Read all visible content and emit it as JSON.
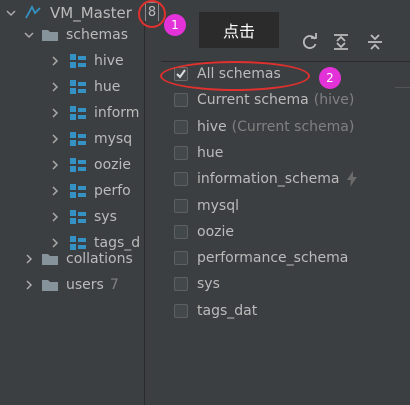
{
  "tree": {
    "datasource": "VM_Master",
    "schemas_label": "schemas",
    "schema_items": [
      "hive",
      "hue",
      "inform",
      "mysq",
      "oozie",
      "perfo",
      "sys",
      "tags_d"
    ],
    "collations_label": "collations",
    "users_label": "users",
    "users_count": "7"
  },
  "badge": {
    "value": "8"
  },
  "annotation": {
    "tooltip": "点击",
    "marker1": "1",
    "marker2": "2"
  },
  "popup": {
    "toolbar": [
      "refresh-icon",
      "expand-all-icon",
      "collapse-all-icon"
    ],
    "options": [
      {
        "label": "All schemas",
        "checked": true,
        "note": ""
      },
      {
        "label": "Current schema",
        "checked": false,
        "note": "(hive)"
      },
      {
        "label": "hive",
        "checked": false,
        "note": "(Current schema)"
      },
      {
        "label": "hue",
        "checked": false,
        "note": ""
      },
      {
        "label": "information_schema",
        "checked": false,
        "note": ""
      },
      {
        "label": "mysql",
        "checked": false,
        "note": ""
      },
      {
        "label": "oozie",
        "checked": false,
        "note": ""
      },
      {
        "label": "performance_schema",
        "checked": false,
        "note": ""
      },
      {
        "label": "sys",
        "checked": false,
        "note": ""
      },
      {
        "label": "tags_dat",
        "checked": false,
        "note": ""
      }
    ]
  },
  "colors": {
    "accent_marker": "#e332d8",
    "ring": "#e0312f",
    "icon_blue": "#3592c4"
  }
}
